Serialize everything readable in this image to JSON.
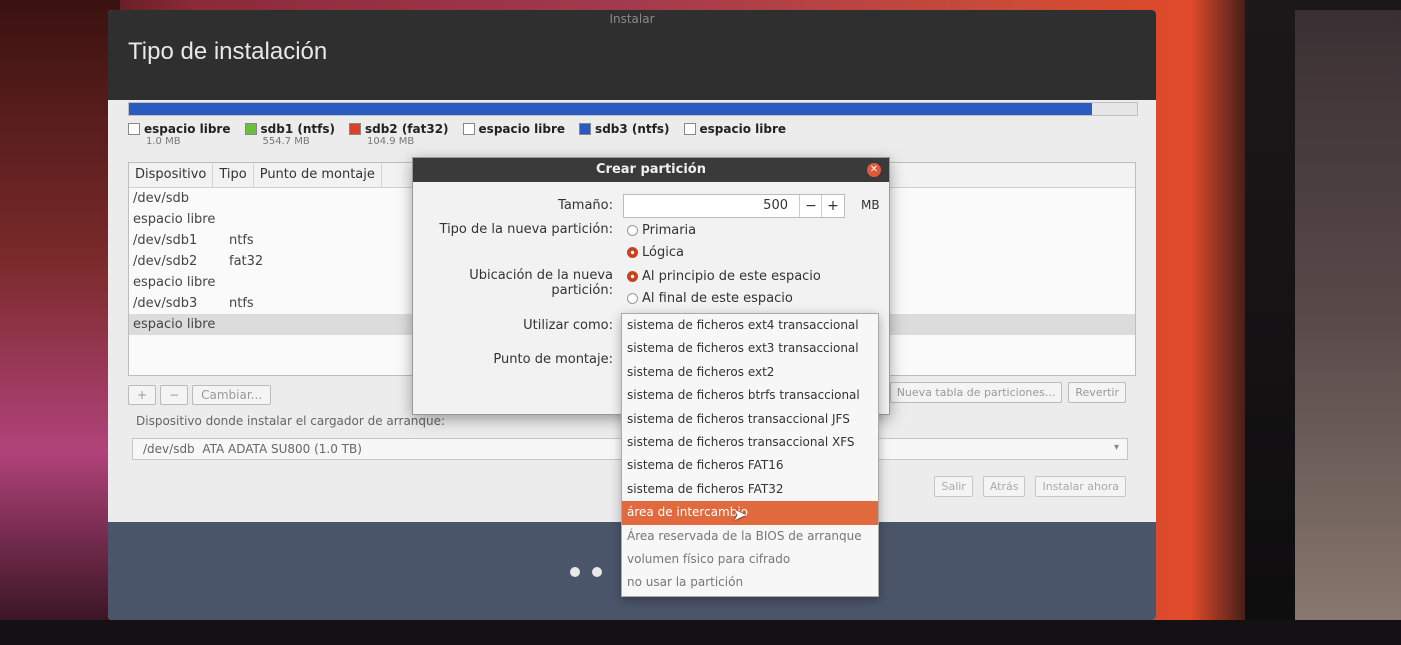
{
  "window": {
    "wm_title": "Instalar",
    "page_title": "Tipo de instalación"
  },
  "legend": [
    {
      "name": "espacio libre",
      "size": "1.0 MB",
      "color": "#ffffff"
    },
    {
      "name": "sdb1 (ntfs)",
      "size": "554.7 MB",
      "color": "#6bbf3b"
    },
    {
      "name": "sdb2 (fat32)",
      "size": "104.9 MB",
      "color": "#d9412a"
    },
    {
      "name": "espacio libre",
      "size": "",
      "color": "#ffffff"
    },
    {
      "name": "sdb3 (ntfs)",
      "size": "",
      "color": "#2a5bc0"
    },
    {
      "name": "espacio libre",
      "size": "",
      "color": "#ffffff"
    }
  ],
  "table": {
    "headers": [
      "Dispositivo",
      "Tipo",
      "Punto de montaje"
    ],
    "rows": [
      {
        "device": "/dev/sdb",
        "type": ""
      },
      {
        "device": "espacio libre",
        "type": ""
      },
      {
        "device": "/dev/sdb1",
        "type": "ntfs"
      },
      {
        "device": "/dev/sdb2",
        "type": "fat32"
      },
      {
        "device": "espacio libre",
        "type": ""
      },
      {
        "device": "/dev/sdb3",
        "type": "ntfs"
      },
      {
        "device": "espacio libre",
        "type": ""
      }
    ]
  },
  "controls": {
    "add": "+",
    "remove": "−",
    "change": "Cambiar..."
  },
  "table_actions": {
    "new_table": "Nueva tabla de particiones...",
    "revert": "Revertir"
  },
  "bootloader": {
    "label": "Dispositivo donde instalar el cargador de arranque:",
    "device": "/dev/sdb",
    "model": "ATA ADATA SU800 (1.0 TB)"
  },
  "nav": {
    "quit": "Salir",
    "back": "Atrás",
    "install": "Instalar ahora"
  },
  "dialog": {
    "title": "Crear partición",
    "size_label": "Tamaño:",
    "size_value": "500",
    "size_unit": "MB",
    "type_label": "Tipo de la nueva partición:",
    "type_primary": "Primaria",
    "type_logical": "Lógica",
    "location_label": "Ubicación de la nueva partición:",
    "location_start": "Al principio de este espacio",
    "location_end": "Al final de este espacio",
    "use_as_label": "Utilizar como:",
    "mount_label": "Punto de montaje:"
  },
  "use_as_options": [
    "sistema de ficheros ext4 transaccional",
    "sistema de ficheros ext3 transaccional",
    "sistema de ficheros ext2",
    "sistema de ficheros btrfs transaccional",
    "sistema de ficheros transaccional JFS",
    "sistema de ficheros transaccional XFS",
    "sistema de ficheros FAT16",
    "sistema de ficheros FAT32",
    "área de intercambio",
    "Área reservada de la BIOS de arranque",
    "volumen físico para cifrado",
    "no usar la partición"
  ],
  "highlighted_option_index": 8
}
